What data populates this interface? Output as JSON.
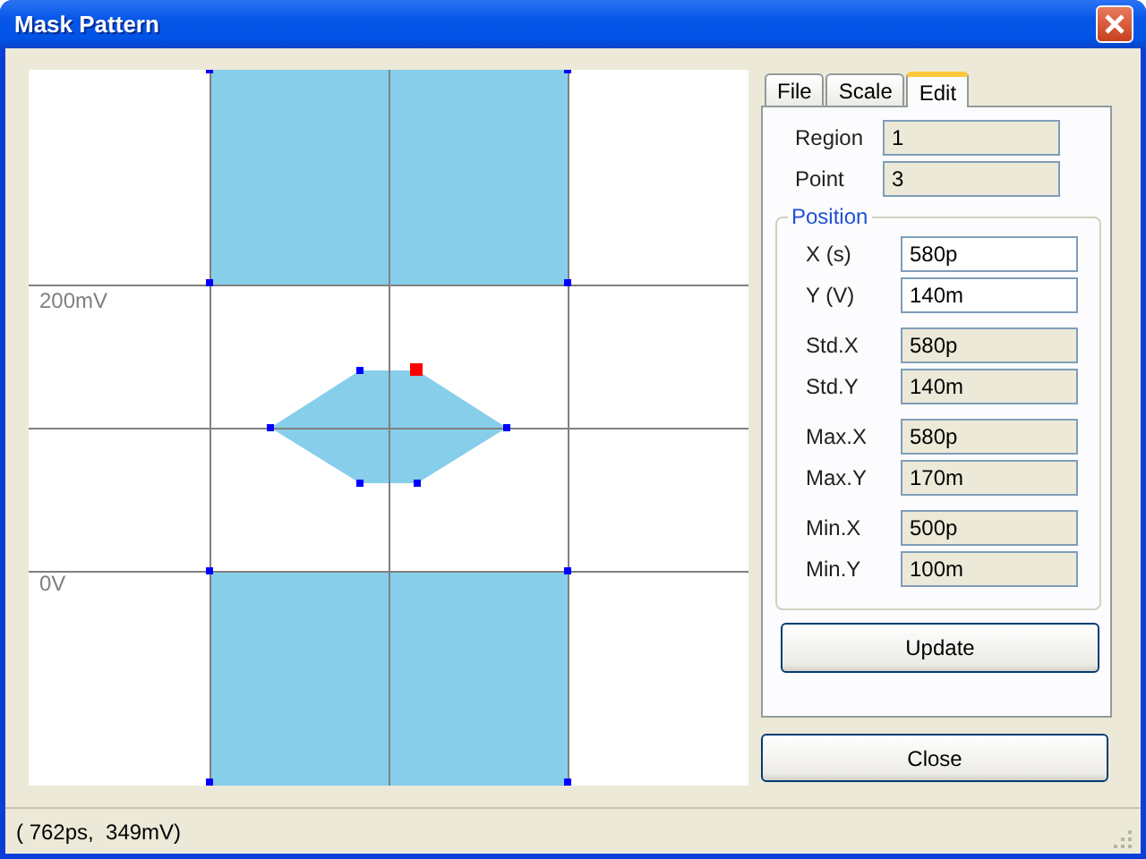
{
  "window": {
    "title": "Mask Pattern"
  },
  "plot": {
    "y_labels": [
      "200mV",
      "0V"
    ]
  },
  "tabs": [
    {
      "label": "File",
      "selected": false
    },
    {
      "label": "Scale",
      "selected": false
    },
    {
      "label": "Edit",
      "selected": true
    }
  ],
  "info": [
    {
      "label": "Region",
      "value": "1"
    },
    {
      "label": "Point",
      "value": "3"
    }
  ],
  "position": {
    "title": "Position",
    "groups": [
      [
        {
          "label": "X (s)",
          "value": "580p",
          "kind": "input"
        },
        {
          "label": "Y (V)",
          "value": "140m",
          "kind": "input"
        }
      ],
      [
        {
          "label": "Std.X",
          "value": "580p",
          "kind": "readonly"
        },
        {
          "label": "Std.Y",
          "value": "140m",
          "kind": "readonly"
        }
      ],
      [
        {
          "label": "Max.X",
          "value": "580p",
          "kind": "readonly"
        },
        {
          "label": "Max.Y",
          "value": "170m",
          "kind": "readonly"
        }
      ],
      [
        {
          "label": "Min.X",
          "value": "500p",
          "kind": "readonly"
        },
        {
          "label": "Min.Y",
          "value": "100m",
          "kind": "readonly"
        }
      ]
    ]
  },
  "update_button": "Update",
  "close_button": "Close",
  "status_bar": "( 762ps,  349mV)"
}
